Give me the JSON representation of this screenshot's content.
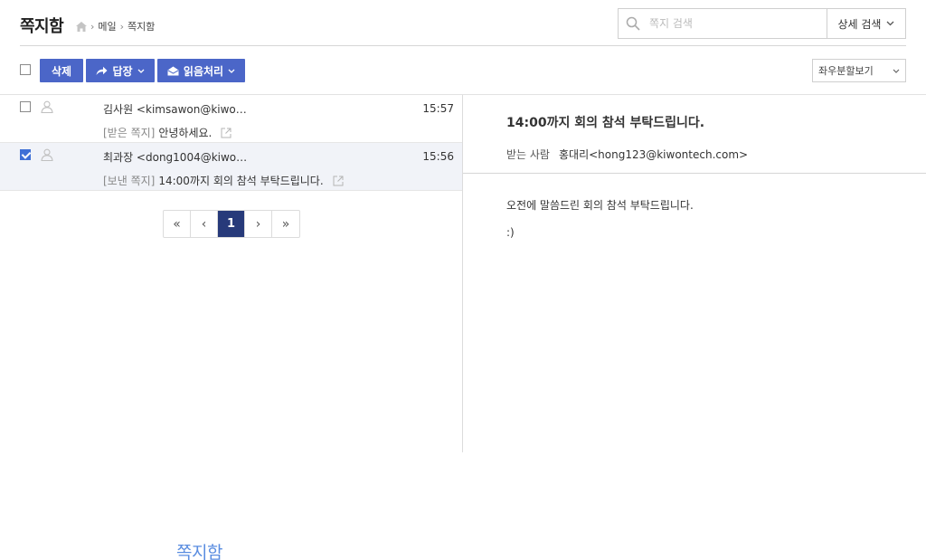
{
  "header": {
    "title": "쪽지함",
    "breadcrumb": [
      "메일",
      "쪽지함"
    ],
    "search_placeholder": "쪽지 검색",
    "advanced_search_label": "상세 검색"
  },
  "toolbar": {
    "delete_label": "삭제",
    "reply_label": "답장",
    "read_label": "읽음처리",
    "view_mode": "좌우분할보기"
  },
  "messages": [
    {
      "sender": "김사원 <kimsawon@kiwo…",
      "time": "15:57",
      "kind": "[받은 쪽지]",
      "subject": "안녕하세요.",
      "checked": false
    },
    {
      "sender": "최과장 <dong1004@kiwo…",
      "time": "15:56",
      "kind": "[보낸 쪽지]",
      "subject": "14:00까지 회의 참석 부탁드립니다.",
      "checked": true
    }
  ],
  "pagination": {
    "first": "«",
    "prev": "‹",
    "current": "1",
    "next": "›",
    "last": "»"
  },
  "reader": {
    "subject": "14:00까지 회의 참석 부탁드립니다.",
    "recipient_label": "받는 사람",
    "recipient": "홍대리<hong123@kiwontech.com>",
    "body_line1": "오전에 말씀드린 회의 참석 부탁드립니다.",
    "body_line2": ":)"
  },
  "footer": {
    "caption": "쪽지함"
  },
  "colors": {
    "primary_button": "#4b66c8",
    "active_page": "#273a7a",
    "checkbox_checked": "#3e6fd6",
    "caption": "#5a8de0"
  }
}
